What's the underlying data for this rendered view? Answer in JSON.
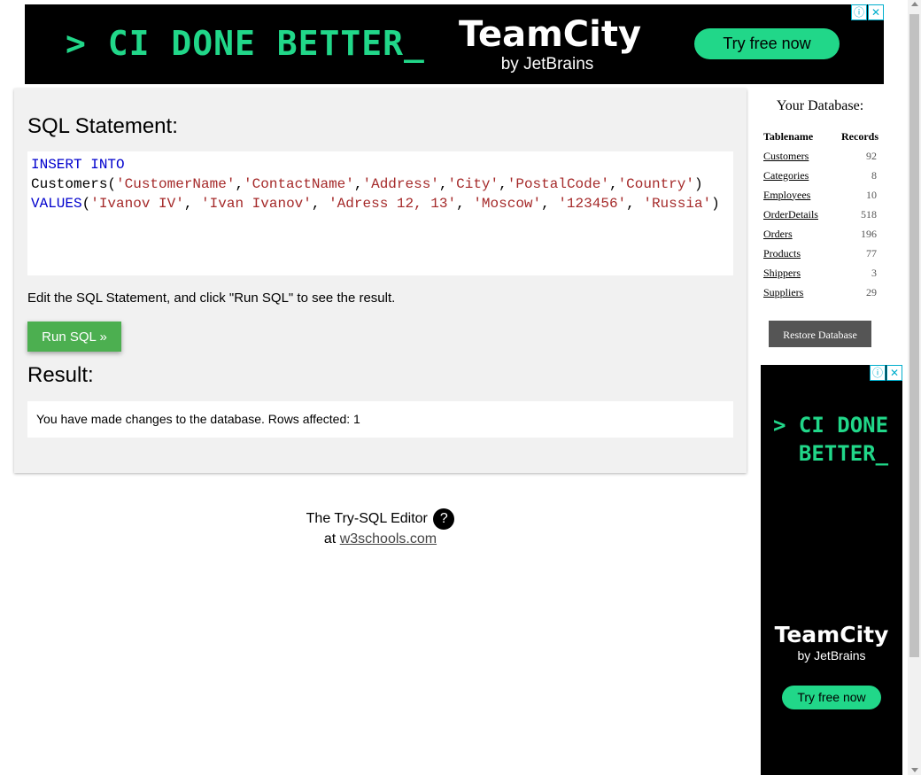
{
  "top_ad": {
    "tagline": "> CI DONE BETTER_",
    "brand": "TeamCity",
    "by": "by JetBrains",
    "cta": "Try free now",
    "info_icon": "info-icon",
    "close_icon": "close-icon",
    "accent_color": "#21d789"
  },
  "editor": {
    "sql_heading": "SQL Statement:",
    "code_lines": [
      [
        {
          "t": "INSERT INTO",
          "c": "kw"
        }
      ],
      [
        {
          "t": "Customers(",
          "c": "pn"
        },
        {
          "t": "'CustomerName'",
          "c": "str"
        },
        {
          "t": ",",
          "c": "pn"
        },
        {
          "t": "'ContactName'",
          "c": "str"
        },
        {
          "t": ",",
          "c": "pn"
        },
        {
          "t": "'Address'",
          "c": "str"
        },
        {
          "t": ",",
          "c": "pn"
        },
        {
          "t": "'City'",
          "c": "str"
        },
        {
          "t": ",",
          "c": "pn"
        },
        {
          "t": "'PostalCode'",
          "c": "str"
        },
        {
          "t": ",",
          "c": "pn"
        },
        {
          "t": "'Country'",
          "c": "str"
        },
        {
          "t": ")",
          "c": "pn"
        }
      ],
      [
        {
          "t": "VALUES",
          "c": "kw"
        },
        {
          "t": "(",
          "c": "pn"
        },
        {
          "t": "'Ivanov IV'",
          "c": "str"
        },
        {
          "t": ", ",
          "c": "pn"
        },
        {
          "t": "'Ivan Ivanov'",
          "c": "str"
        },
        {
          "t": ", ",
          "c": "pn"
        },
        {
          "t": "'Adress 12, 13'",
          "c": "str"
        },
        {
          "t": ", ",
          "c": "pn"
        },
        {
          "t": "'Moscow'",
          "c": "str"
        },
        {
          "t": ", ",
          "c": "pn"
        },
        {
          "t": "'123456'",
          "c": "str"
        },
        {
          "t": ", ",
          "c": "pn"
        },
        {
          "t": "'Russia'",
          "c": "str"
        },
        {
          "t": ")",
          "c": "pn"
        }
      ]
    ],
    "hint": "Edit the SQL Statement, and click \"Run SQL\" to see the result.",
    "run_button": "Run SQL »",
    "result_heading": "Result:",
    "result_text": "You have made changes to the database. Rows affected: 1",
    "run_button_color": "#4caf50"
  },
  "footer": {
    "title": "The Try-SQL Editor",
    "help": "?",
    "at": "at",
    "link": "w3schools.com"
  },
  "database": {
    "title": "Your Database:",
    "headers": {
      "table": "Tablename",
      "records": "Records"
    },
    "tables": [
      {
        "name": "Customers",
        "records": "92"
      },
      {
        "name": "Categories",
        "records": "8"
      },
      {
        "name": "Employees",
        "records": "10"
      },
      {
        "name": "OrderDetails",
        "records": "518"
      },
      {
        "name": "Orders",
        "records": "196"
      },
      {
        "name": "Products",
        "records": "77"
      },
      {
        "name": "Shippers",
        "records": "3"
      },
      {
        "name": "Suppliers",
        "records": "29"
      }
    ],
    "restore_button": "Restore Database"
  },
  "side_ad": {
    "tagline": "> CI DONE\n  BETTER_",
    "brand": "TeamCity",
    "by": "by JetBrains",
    "cta": "Try free now"
  }
}
